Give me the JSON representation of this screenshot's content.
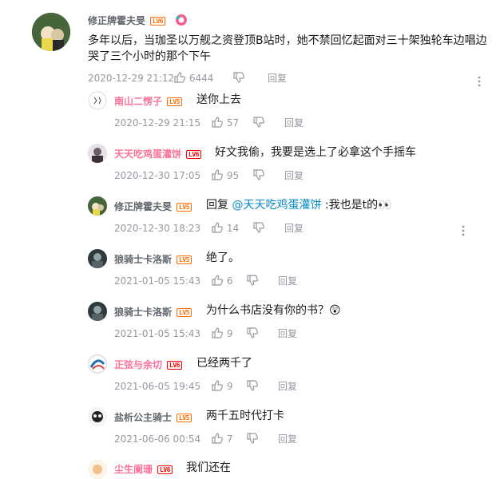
{
  "root_comment": {
    "user": "修正牌霍夫旻",
    "level": "LV6",
    "level_color": "#ff6c00",
    "name_color": "#61666d",
    "content": "多年以后，当珈圣以万舰之资登顶B站时，她不禁回忆起面对三十架独轮车边唱边哭了三个小时的那个下午",
    "time": "2020-12-29 21:12",
    "likes": "6444",
    "reply_label": "回复"
  },
  "replies": [
    {
      "user": "南山二愣子",
      "level": "LV5",
      "name_color": "#fb7299",
      "content": "送你上去",
      "time": "2020-12-29 21:15",
      "likes": "57",
      "reply_label": "回复"
    },
    {
      "user": "天天吃鸡蛋灌饼",
      "level": "LV6",
      "name_color": "#fb7299",
      "content": "好文我偷，我要是选上了必拿这个手摇车",
      "time": "2020-12-30 17:05",
      "likes": "95",
      "reply_label": "回复"
    },
    {
      "user": "修正牌霍夫旻",
      "level": "LV5",
      "name_color": "#61666d",
      "content_prefix": "回复 ",
      "mention": "@天天吃鸡蛋灌饼",
      "content_suffix": " :我也是t的👀",
      "time": "2020-12-30 18:23",
      "likes": "14",
      "reply_label": "回复"
    },
    {
      "user": "狼骑士卡洛斯",
      "level": "LV5",
      "name_color": "#61666d",
      "content": "绝了。",
      "time": "2021-01-05 15:43",
      "likes": "6",
      "reply_label": "回复"
    },
    {
      "user": "狼骑士卡洛斯",
      "level": "LV5",
      "name_color": "#61666d",
      "content": "为什么书店没有你的书？😲",
      "time": "2021-01-05 15:43",
      "likes": "9",
      "reply_label": "回复"
    },
    {
      "user": "正弦与余切",
      "level": "LV6",
      "name_color": "#fb7299",
      "content": "已经两千了",
      "time": "2021-06-05 19:45",
      "likes": "9",
      "reply_label": "回复"
    },
    {
      "user": "盐析公主骑士",
      "level": "LV5",
      "name_color": "#61666d",
      "content": "两千五时代打卡",
      "time": "2021-06-06 00:54",
      "likes": "7",
      "reply_label": "回复"
    },
    {
      "user": "尘生阑珊",
      "level": "LV6",
      "name_color": "#fb7299",
      "content": "我们还在"
    }
  ]
}
